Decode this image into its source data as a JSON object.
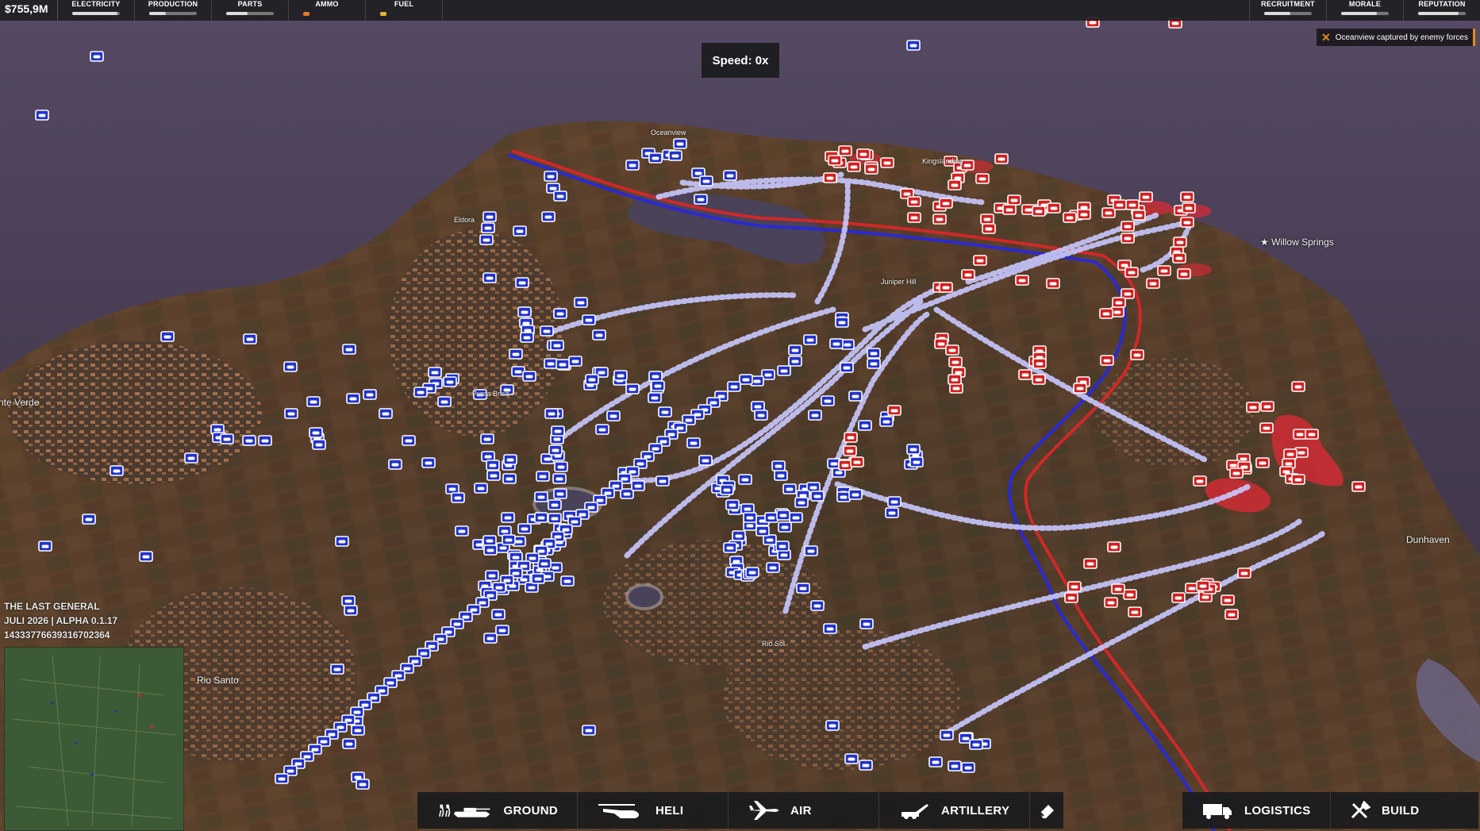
{
  "hud": {
    "money": "$755,9M",
    "left_resources": [
      {
        "label": "ELECTRICITY",
        "level": 0.95,
        "indicator": "bar",
        "color": "#dddddd"
      },
      {
        "label": "PRODUCTION",
        "level": 0.35,
        "indicator": "bar",
        "color": "#dddddd"
      },
      {
        "label": "PARTS",
        "level": 0.45,
        "indicator": "bar",
        "color": "#dddddd"
      },
      {
        "label": "AMMO",
        "level": 0.08,
        "indicator": "dot",
        "color": "#e07a26"
      },
      {
        "label": "FUEL",
        "level": 0.15,
        "indicator": "dot",
        "color": "#e8b430"
      }
    ],
    "right_resources": [
      {
        "label": "RECRUITMENT",
        "level": 0.55,
        "color": "#dddddd"
      },
      {
        "label": "MORALE",
        "level": 0.75,
        "color": "#dddddd"
      },
      {
        "label": "REPUTATION",
        "level": 0.85,
        "color": "#dddddd"
      }
    ],
    "speed": "Speed: 0x",
    "notification": "Oceanview captured by enemy forces"
  },
  "version_info": {
    "line1": "THE LAST GENERAL",
    "line2": "JULI 2026 | ALPHA 0.1.17",
    "line3": "14333776639316702364"
  },
  "map": {
    "locations": [
      {
        "name": "Oceanview",
        "size": "small"
      },
      {
        "name": "Kingslanding",
        "size": "small"
      },
      {
        "name": "★ Willow Springs",
        "size": "normal"
      },
      {
        "name": "Eldora",
        "size": "small"
      },
      {
        "name": "Juniper Hill",
        "size": "small"
      },
      {
        "name": "Punta Brisa",
        "size": "small"
      },
      {
        "name": "nte Verde",
        "size": "normal"
      },
      {
        "name": "Dunhaven",
        "size": "normal"
      },
      {
        "name": "Rio Sol",
        "size": "small"
      },
      {
        "name": "Rio Santo",
        "size": "normal"
      }
    ],
    "friendly_color": "#2233cc",
    "enemy_color": "#d42020",
    "order_arrow_color": "#b8b8ff"
  },
  "bottom_bar": {
    "unit_tabs": [
      {
        "label": "GROUND",
        "icon": "infantry-tank-icon"
      },
      {
        "label": "HELI",
        "icon": "helicopter-icon"
      },
      {
        "label": "AIR",
        "icon": "jet-icon"
      },
      {
        "label": "ARTILLERY",
        "icon": "artillery-icon"
      }
    ],
    "eraser_icon": "eraser-icon",
    "right_tabs": [
      {
        "label": "LOGISTICS",
        "icon": "truck-icon"
      },
      {
        "label": "BUILD",
        "icon": "tools-icon"
      }
    ]
  }
}
